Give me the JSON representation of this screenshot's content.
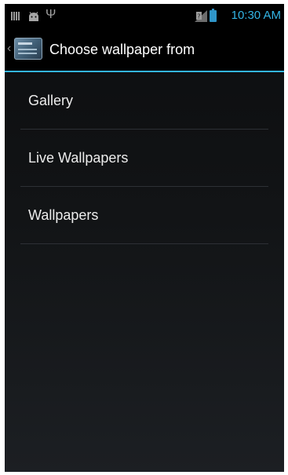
{
  "status_bar": {
    "time": "10:30 AM",
    "icons": [
      "signal-bars-icon",
      "android-icon",
      "usb-icon",
      "no-sim-signal-icon",
      "battery-icon"
    ],
    "accent_color": "#33b5e5"
  },
  "action_bar": {
    "title": "Choose wallpaper from",
    "up_icon": "chevron-left-icon",
    "app_icon": "wallpaper-app-icon",
    "divider_color": "#33b5e5"
  },
  "list": {
    "items": [
      {
        "label": "Gallery"
      },
      {
        "label": "Live Wallpapers"
      },
      {
        "label": "Wallpapers"
      }
    ]
  }
}
